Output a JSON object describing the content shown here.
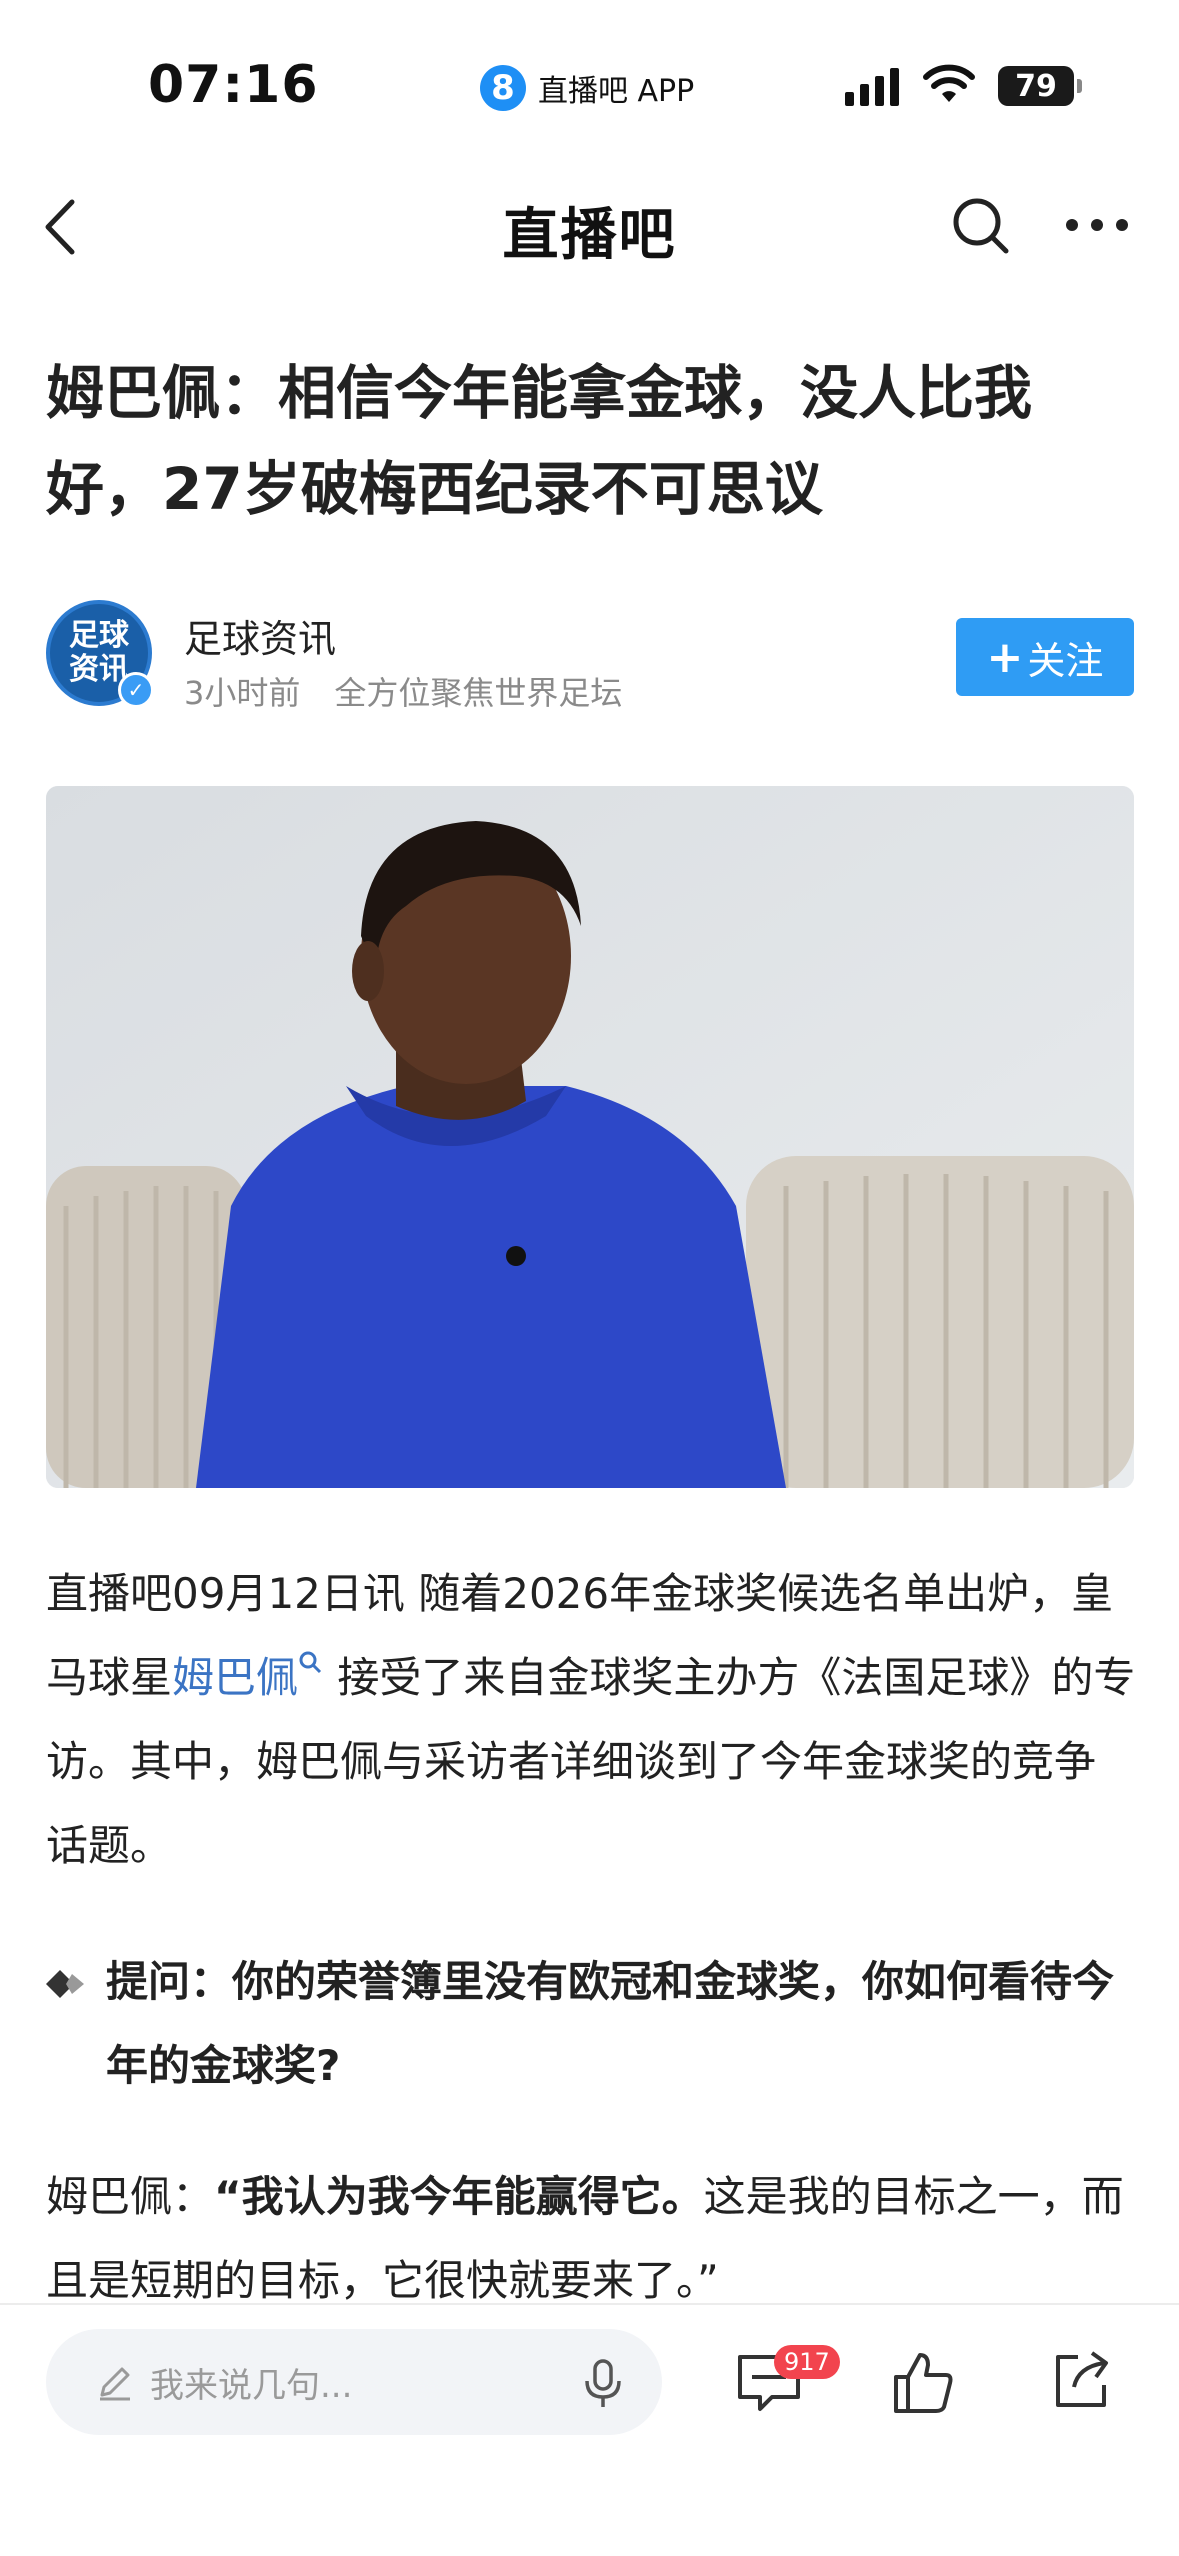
{
  "status_bar": {
    "time": "07:16",
    "app_name": "直播吧 APP",
    "app_logo_char": "8",
    "battery": "79"
  },
  "nav": {
    "title": "直播吧"
  },
  "article": {
    "headline": "姆巴佩：相信今年能拿金球，没人比我好，27岁破梅西纪录不可思议",
    "author": {
      "name": "足球资讯",
      "avatar_text_line1": "足球",
      "avatar_text_line2": "资讯",
      "time_ago": "3小时前",
      "tagline": "全方位聚焦世界足坛",
      "follow_label": "关注"
    },
    "hero_image_alt": "姆巴佩 接受采访",
    "para1_before": "直播吧09月12日讯  随着2026年金球奖候选名单出炉，皇马球星",
    "para1_mention": "姆巴佩",
    "para1_after": " 接受了来自金球奖主办方《法国足球》的专访。其中，姆巴佩与采访者详细谈到了今年金球奖的竞争话题。",
    "question": "提问：你的荣誉簿里没有欧冠和金球奖，你如何看待今年的金球奖?",
    "para2_speaker": "姆巴佩：",
    "para2_quote": "“我认为我今年能赢得它。",
    "para2_rest": "这是我的目标之一，而且是短期的目标，它很快就要来了。”"
  },
  "bottom_bar": {
    "comment_placeholder": "我来说几句...",
    "comment_count": "917"
  },
  "colors": {
    "accent": "#2f9cf4",
    "mention": "#3b74c4",
    "badge": "#f2444e"
  }
}
